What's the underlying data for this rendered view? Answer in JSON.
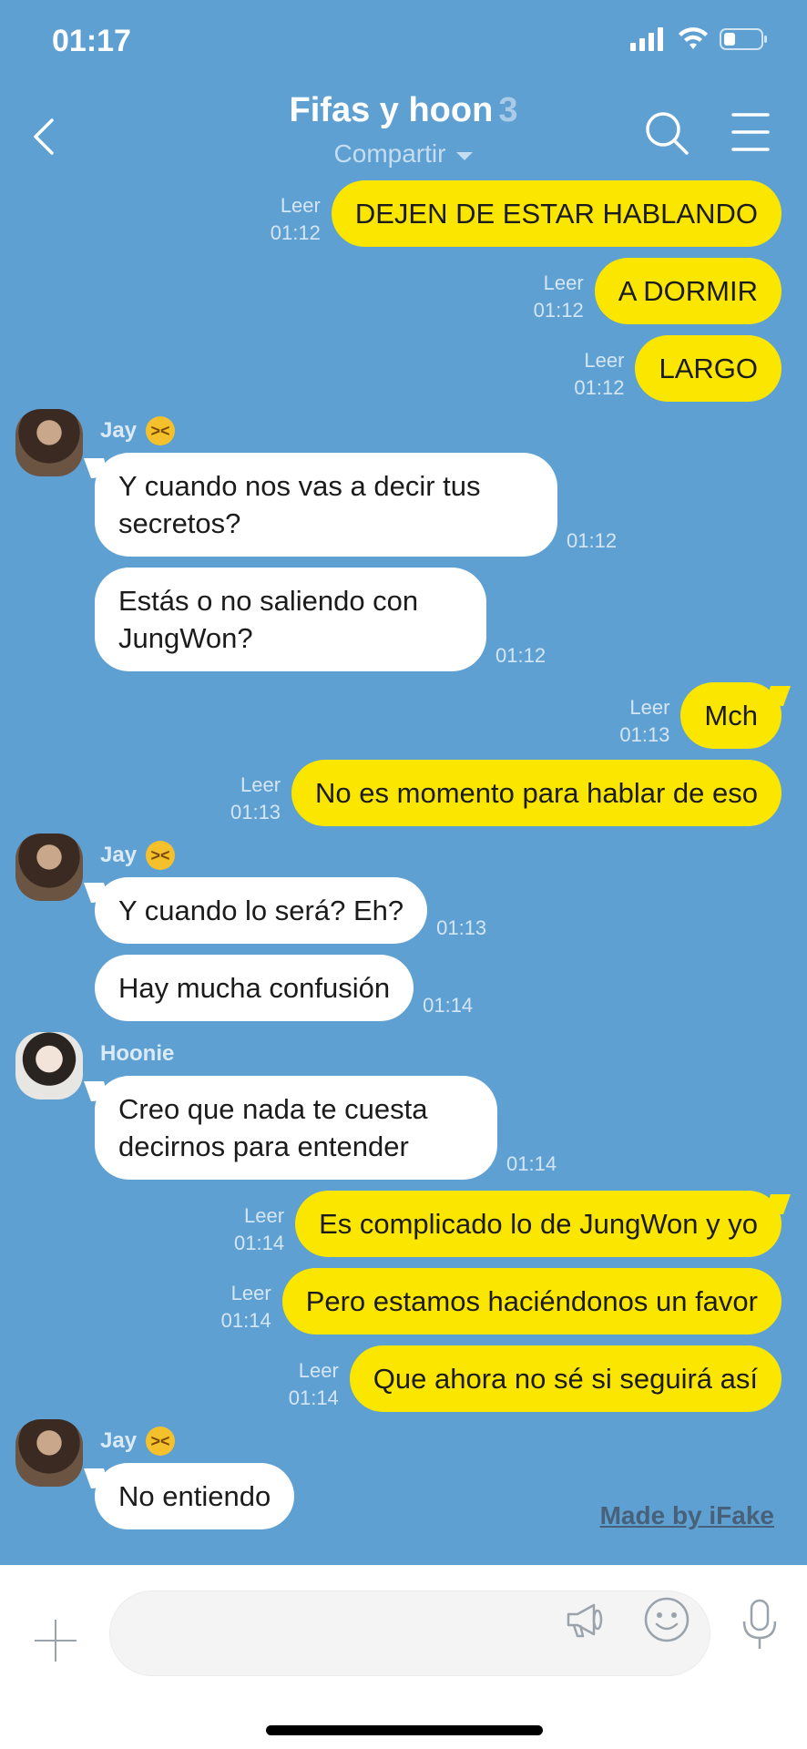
{
  "status_bar": {
    "time": "01:17"
  },
  "header": {
    "title": "Fifas y hoon",
    "member_count": "3",
    "share_label": "Compartir"
  },
  "messages": [
    {
      "type": "out",
      "text": "DEJEN DE ESTAR HABLANDO",
      "read": "Leer",
      "time": "01:12"
    },
    {
      "type": "out",
      "text": "A DORMIR",
      "read": "Leer",
      "time": "01:12"
    },
    {
      "type": "out",
      "text": "LARGO",
      "read": "Leer",
      "time": "01:12"
    },
    {
      "type": "sender",
      "name": "Jay",
      "emoji": "angry-cat-emoji"
    },
    {
      "type": "in",
      "text": "Y cuando nos vas a decir tus secretos?",
      "time": "01:12"
    },
    {
      "type": "in",
      "text": "Estás o no saliendo con JungWon?",
      "time": "01:12"
    },
    {
      "type": "out",
      "text": "Mch",
      "read": "Leer",
      "time": "01:13"
    },
    {
      "type": "out",
      "text": "No es momento para hablar de eso",
      "read": "Leer",
      "time": "01:13"
    },
    {
      "type": "sender",
      "name": "Jay",
      "emoji": "angry-cat-emoji"
    },
    {
      "type": "in",
      "text": "Y cuando lo será? Eh?",
      "time": "01:13"
    },
    {
      "type": "in",
      "text": "Hay mucha confusión",
      "time": "01:14"
    },
    {
      "type": "sender",
      "name": "Hoonie"
    },
    {
      "type": "in",
      "text": "Creo que nada te cuesta decirnos para entender",
      "time": "01:14"
    },
    {
      "type": "out",
      "text": "Es complicado lo de JungWon y yo",
      "read": "Leer",
      "time": "01:14"
    },
    {
      "type": "out",
      "text": "Pero estamos haciéndonos un favor",
      "read": "Leer",
      "time": "01:14"
    },
    {
      "type": "out",
      "text": "Que ahora no sé si seguirá así",
      "read": "Leer",
      "time": "01:14"
    },
    {
      "type": "sender",
      "name": "Jay",
      "emoji": "angry-cat-emoji"
    },
    {
      "type": "in",
      "text": "No entiendo",
      "time": ""
    }
  ],
  "watermark": "Made by iFake",
  "composer": {
    "placeholder": ""
  },
  "colors": {
    "background": "#5fa0d3",
    "outgoing_bubble": "#fbe600",
    "incoming_bubble": "#ffffff"
  }
}
